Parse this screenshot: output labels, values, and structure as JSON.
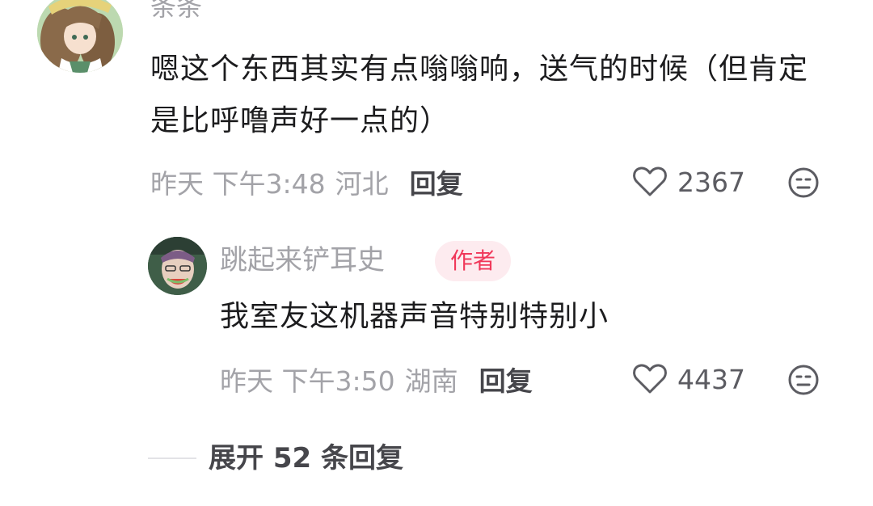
{
  "main_comment": {
    "username": "条条",
    "content": "嗯这个东西其实有点嗡嗡响，送气的时候（但肯定是比呼噜声好一点的）",
    "time": "昨天 下午3:48",
    "location": "河北",
    "reply_label": "回复",
    "like_count": "2367",
    "icons": [
      "avatar",
      "heart-icon",
      "dislike-face-icon"
    ]
  },
  "reply_comment": {
    "username": "跳起来铲耳史",
    "author_badge": "作者",
    "content": "我室友这机器声音特别特别小",
    "time": "昨天 下午3:50",
    "location": "湖南",
    "reply_label": "回复",
    "like_count": "4437",
    "icons": [
      "avatar",
      "heart-icon",
      "dislike-face-icon"
    ]
  },
  "expand": {
    "label": "展开 52 条回复"
  },
  "colors": {
    "primary_text": "#1c1c1e",
    "secondary_text": "#a3a3a8",
    "action_text": "#46464b",
    "badge_text": "#f0385a",
    "badge_background": "#fdebef"
  }
}
